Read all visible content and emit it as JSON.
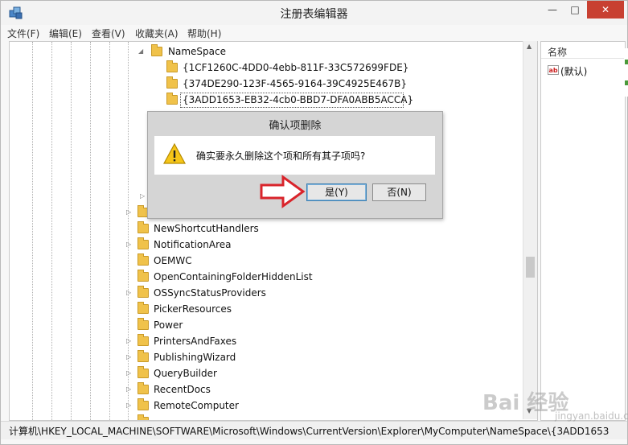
{
  "window": {
    "title": "注册表编辑器",
    "min_label": "—",
    "max_label": "□",
    "close_label": "✕"
  },
  "menu": [
    "文件(F)",
    "编辑(E)",
    "查看(V)",
    "收藏夹(A)",
    "帮助(H)"
  ],
  "tree": {
    "namespace_label": "NameSpace",
    "namespace_children": [
      "{1CF1260C-4DD0-4ebb-811F-33C572699FDE}",
      "{374DE290-123F-4565-9164-39C4925E467B}",
      "{3ADD1653-EB32-4cb0-BBD7-DFA0ABB5ACCA}"
    ],
    "selected_key": "{3ADD1653-EB32-4cb0-BBD7-DFA0ABB5ACCA}",
    "keys": [
      "NewShortcutHandlers",
      "NotificationArea",
      "OEMWC",
      "OpenContainingFolderHiddenList",
      "OSSyncStatusProviders",
      "PickerResources",
      "Power",
      "PrintersAndFaxes",
      "PublishingWizard",
      "QueryBuilder",
      "RecentDocs",
      "RemoteComputer"
    ]
  },
  "right_pane": {
    "column_name": "名称",
    "default_value_label": "(默认)",
    "value_icon": "ab"
  },
  "status": {
    "path": "计算机\\HKEY_LOCAL_MACHINE\\SOFTWARE\\Microsoft\\Windows\\CurrentVersion\\Explorer\\MyComputer\\NameSpace\\{3ADD1653"
  },
  "dialog": {
    "title": "确认项删除",
    "message": "确实要永久删除这个项和所有其子项吗?",
    "yes_label": "是(Y)",
    "no_label": "否(N)"
  },
  "watermark": {
    "text": "Bai 经验",
    "sub": "jingyan.baidu.com"
  },
  "colors": {
    "close_button": "#c84031",
    "folder": "#f0c24a",
    "annotation_arrow": "#d9242b"
  }
}
